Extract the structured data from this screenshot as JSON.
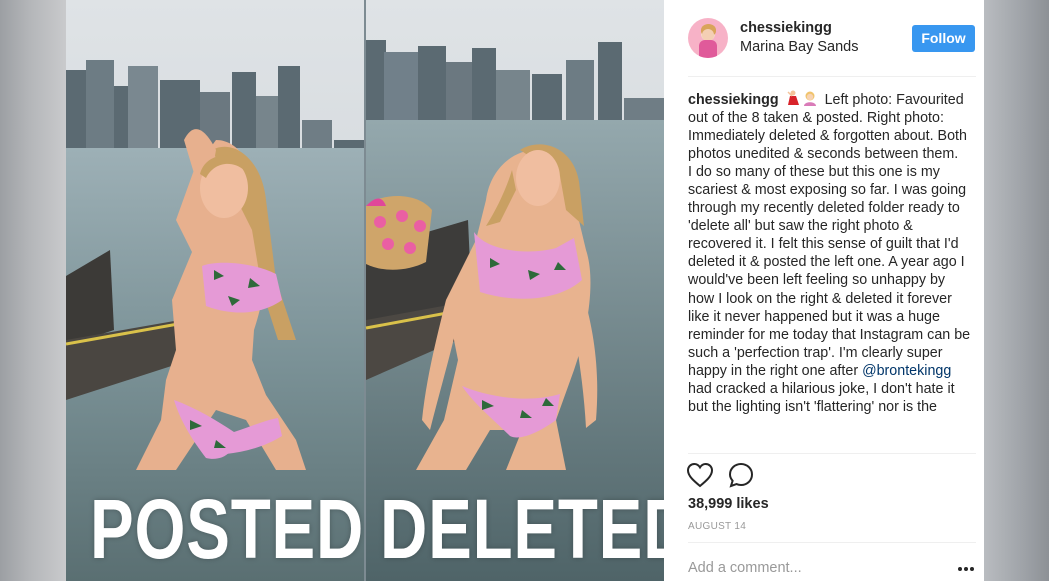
{
  "photo": {
    "left_caption": "POSTED",
    "right_caption": "DELETED"
  },
  "post": {
    "username": "chessiekingg",
    "location": "Marina Bay Sands",
    "follow_label": "Follow",
    "caption": {
      "username": "chessiekingg",
      "emoji": "dancer-emoji woman-emoji",
      "part1": "Left photo: Favourited out of the 8 taken & posted. Right photo: Immediately deleted & forgotten about. Both photos unedited & seconds between them.",
      "part2": "I do so many of these but this one is my scariest & most exposing so far. I was going through my recently deleted folder ready to 'delete all' but saw the right photo & recovered it. I felt this sense of guilt that I'd deleted it & posted the left one. A year ago I would've been left feeling so unhappy by how I look on the right & deleted it forever like it never happened but it was a huge reminder for me today that Instagram can be such a 'perfection trap'. I'm clearly super happy in the right one after",
      "mention": "@bronteking​g",
      "part3": "had cracked a hilarious joke, I don't hate it but the lighting isn't 'flattering' nor is the"
    },
    "likes": "38,999 likes",
    "date": "AUGUST 14",
    "comment_placeholder": "Add a comment..."
  },
  "colors": {
    "follow_button": "#3897f0",
    "text": "#262626",
    "muted": "#999999",
    "mention": "#003569",
    "bikini": "#e59ad6"
  },
  "icons": [
    "heart-icon",
    "comment-icon",
    "more-options-icon"
  ]
}
